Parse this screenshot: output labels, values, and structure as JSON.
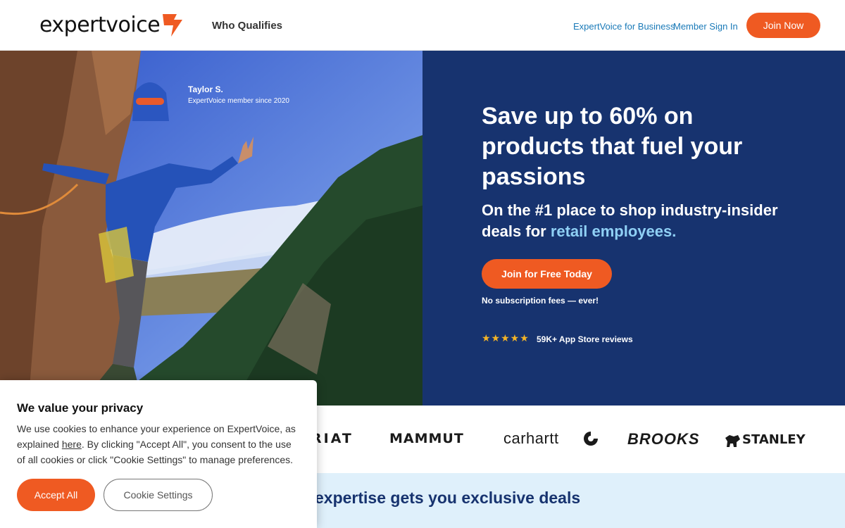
{
  "header": {
    "logo_text": "expertvoice",
    "nav_who": "Who Qualifies",
    "link_business": "ExpertVoice for Business",
    "link_signin": "Member Sign In",
    "join_now": "Join Now"
  },
  "photo": {
    "name": "Taylor S.",
    "since": "ExpertVoice member since 2020"
  },
  "hero": {
    "title": "Save up to 60% on products that fuel your passions",
    "sub_prefix": "On the #1 place to shop industry-insider deals for ",
    "sub_highlight": "retail employees.",
    "cta": "Join for Free Today",
    "no_fees": "No subscription fees — ever!",
    "stars": "★★★★★",
    "reviews": "59K+ App Store reviews"
  },
  "brands": {
    "ariat": "RIAT",
    "mammut": "MAMMUT",
    "carhartt": "carhartt",
    "brooks": "BROOKS",
    "stanley": "STANLEY"
  },
  "band": {
    "text": "expertise gets you exclusive deals"
  },
  "cookie": {
    "title": "We value your privacy",
    "body_prefix": "We use cookies to enhance your experience on ExpertVoice, as explained ",
    "link_here": "here",
    "body_suffix": ". By clicking \"Accept All\", you consent to the use of all cookies or click \"Cookie Settings\" to manage preferences.",
    "accept": "Accept All",
    "settings": "Cookie Settings"
  },
  "colors": {
    "accent": "#ef5a22",
    "navy": "#17336f",
    "highlight": "#8fd0f5",
    "link": "#1a7ab8"
  }
}
